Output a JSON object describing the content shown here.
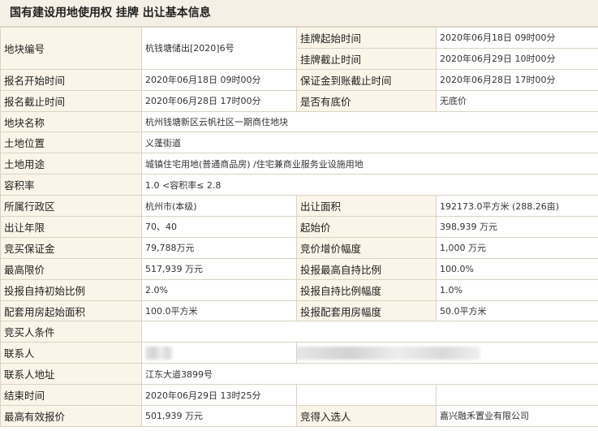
{
  "header": {
    "title": "国有建设用地使用权 挂牌 出让基本信息"
  },
  "rows": {
    "parcel_no": {
      "label": "地块编号",
      "value": "杭钱塘储出[2020]6号"
    },
    "listing_start": {
      "label": "挂牌起始时间",
      "value": "2020年06月18日 09时00分"
    },
    "listing_end": {
      "label": "挂牌截止时间",
      "value": "2020年06月29日 10时00分"
    },
    "reg_start": {
      "label": "报名开始时间",
      "value": "2020年06月18日 09时00分"
    },
    "deposit_deadline": {
      "label": "保证金到账截止时间",
      "value": "2020年06月28日 17时00分"
    },
    "reg_end": {
      "label": "报名截止时间",
      "value": "2020年06月28日 17时00分"
    },
    "reserve_price": {
      "label": "是否有底价",
      "value": "无底价"
    },
    "parcel_name": {
      "label": "地块名称",
      "value": "杭州钱塘新区云帆社区一期商住地块"
    },
    "location": {
      "label": "土地位置",
      "value": "义蓬街道"
    },
    "land_use": {
      "label": "土地用途",
      "value": "城镇住宅用地(普通商品房) /住宅兼商业服务业设施用地"
    },
    "plot_ratio": {
      "label": "容积率",
      "value": "1.0 <容积率≤ 2.8"
    },
    "district": {
      "label": "所属行政区",
      "value": "杭州市(本级)"
    },
    "area": {
      "label": "出让面积",
      "value": "192173.0平方米 (288.26亩)"
    },
    "term": {
      "label": "出让年限",
      "value": "70、40"
    },
    "start_price": {
      "label": "起始价",
      "value": "398,939 万元"
    },
    "bid_deposit": {
      "label": "竞买保证金",
      "value": "79,788万元"
    },
    "increment": {
      "label": "竞价增价幅度",
      "value": "1,000 万元"
    },
    "max_price": {
      "label": "最高限价",
      "value": "517,939 万元"
    },
    "max_self_hold_ratio": {
      "label": "投报最高自持比例",
      "value": "100.0%"
    },
    "init_self_hold_ratio": {
      "label": "投报自持初始比例",
      "value": "2.0%"
    },
    "self_hold_increment": {
      "label": "投报自持比例幅度",
      "value": "1.0%"
    },
    "supporting_start_area": {
      "label": "配套用房起始面积",
      "value": "100.0平方米"
    },
    "supporting_increment": {
      "label": "投报配套用房幅度",
      "value": "50.0平方米"
    },
    "bidder_conditions": {
      "label": "竞买人条件",
      "value": ""
    },
    "contact": {
      "label": "联系人"
    },
    "contact_address": {
      "label": "联系人地址",
      "value": "江东大道3899号"
    },
    "end_time": {
      "label": "结束时间",
      "value": "2020年06月29日 13时25分"
    },
    "highest_bid": {
      "label": "最高有效报价",
      "value": "501,939 万元"
    },
    "winner": {
      "label": "竞得入选人",
      "value": "嘉兴融禾置业有限公司"
    }
  }
}
